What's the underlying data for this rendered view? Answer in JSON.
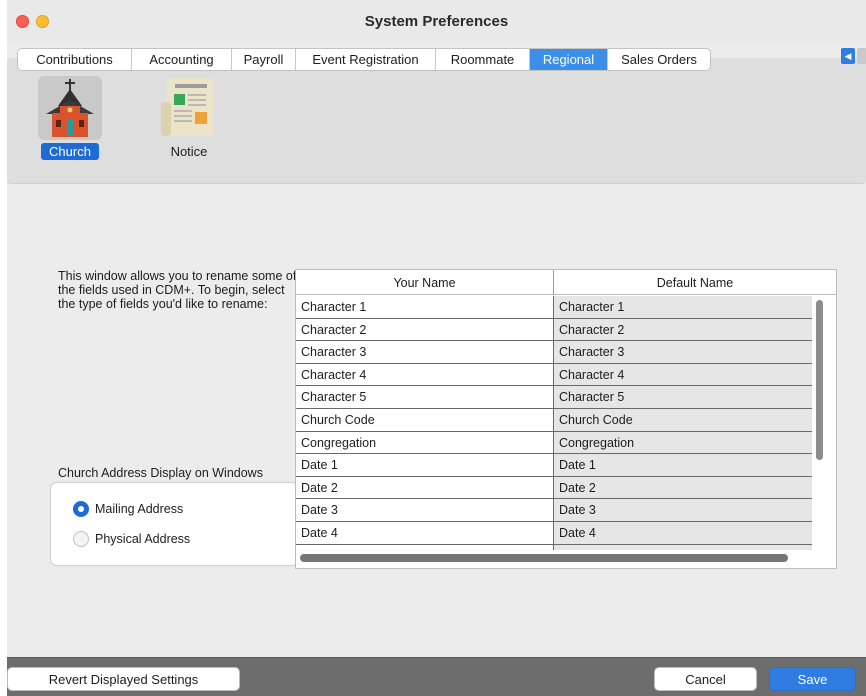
{
  "window": {
    "title": "System Preferences"
  },
  "tabs": [
    {
      "label": "Contributions",
      "active": false
    },
    {
      "label": "Accounting",
      "active": false
    },
    {
      "label": "Payroll",
      "active": false
    },
    {
      "label": "Event Registration",
      "active": false
    },
    {
      "label": "Roommate",
      "active": false
    },
    {
      "label": "Regional",
      "active": true
    },
    {
      "label": "Sales Orders",
      "active": false
    }
  ],
  "toolbar": {
    "items": [
      {
        "label": "Church",
        "icon": "church-icon",
        "selected": true
      },
      {
        "label": "Notice",
        "icon": "notice-icon",
        "selected": false
      }
    ]
  },
  "intro": {
    "text": "This window allows you to rename some of the fields used in CDM+. To begin, select the type of fields you'd like to rename:"
  },
  "address_display": {
    "caption": "Church Address Display on Windows",
    "options": [
      {
        "label": "Mailing Address",
        "selected": true
      },
      {
        "label": "Physical Address",
        "selected": false
      }
    ]
  },
  "grid": {
    "columns": [
      "Your Name",
      "Default Name"
    ],
    "rows": [
      [
        "Character 1",
        "Character 1"
      ],
      [
        "Character 2",
        "Character 2"
      ],
      [
        "Character 3",
        "Character 3"
      ],
      [
        "Character 4",
        "Character 4"
      ],
      [
        "Character 5",
        "Character 5"
      ],
      [
        "Church Code",
        "Church Code"
      ],
      [
        "Congregation",
        "Congregation"
      ],
      [
        "Date 1",
        "Date 1"
      ],
      [
        "Date 2",
        "Date 2"
      ],
      [
        "Date 3",
        "Date 3"
      ],
      [
        "Date 4",
        "Date 4"
      ],
      [
        "",
        ""
      ]
    ]
  },
  "footer": {
    "revert_label": "Revert Displayed Settings",
    "cancel_label": "Cancel",
    "save_label": "Save"
  },
  "colors": {
    "accent": "#2f7de0",
    "tab_active": "#3d8ee8",
    "footer_bg": "#6d6d6d"
  }
}
